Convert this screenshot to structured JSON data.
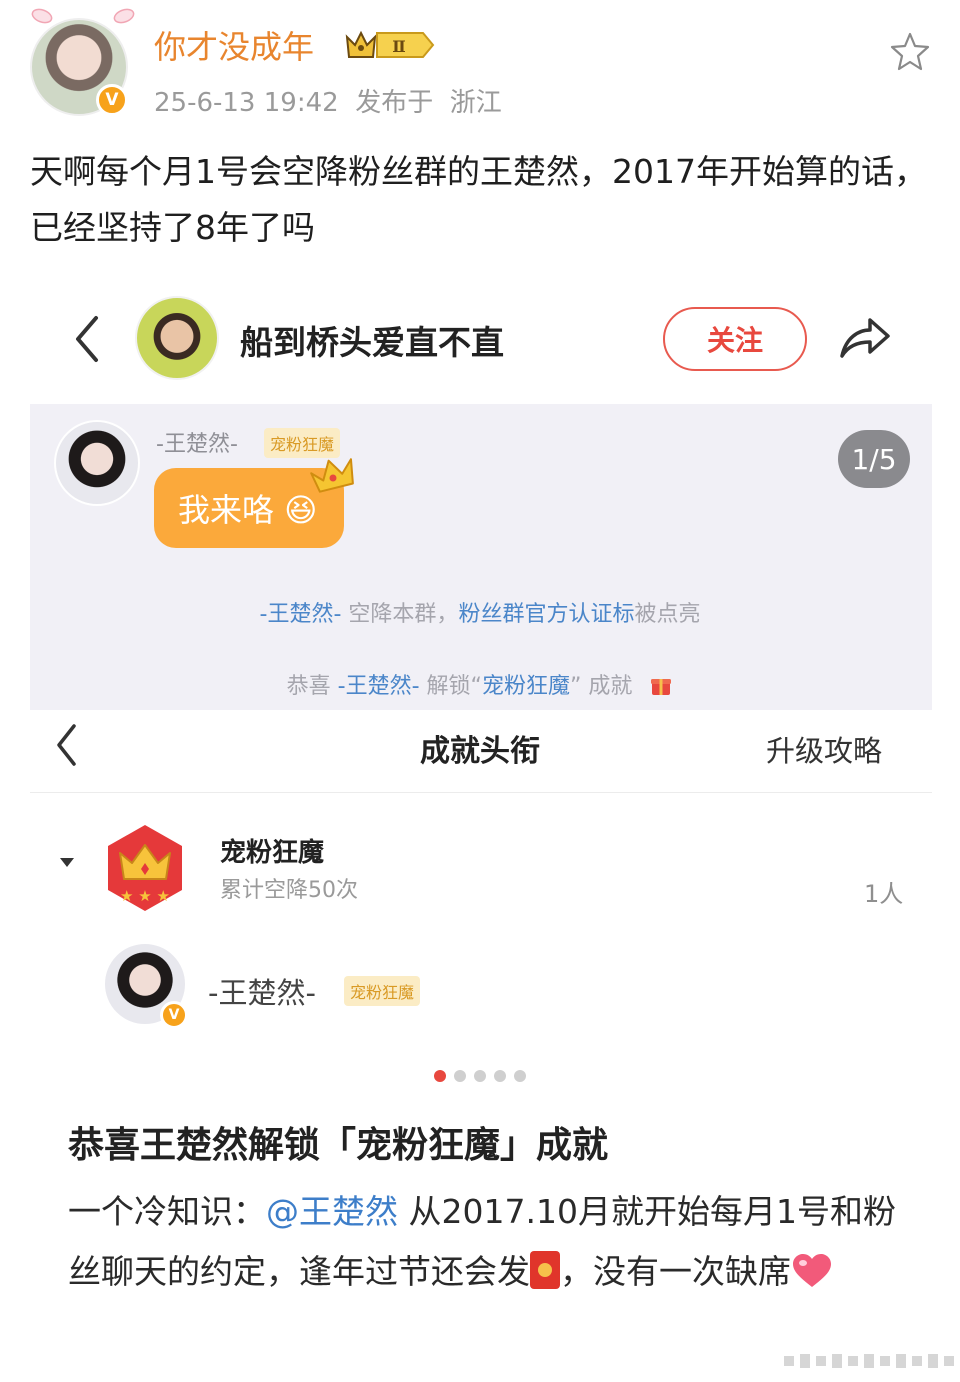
{
  "post": {
    "username": "你才没成年",
    "level_badge": "Ⅱ",
    "timestamp": "25-6-13 19:42",
    "location_prefix": "发布于",
    "location": "浙江",
    "verified_mark": "V",
    "text": "天啊每个月1号会空降粉丝群的王楚然，2017年开始算的话，已经坚持了8年了吗"
  },
  "chat_header": {
    "group_name": "船到桥头爱直不直",
    "follow_label": "关注"
  },
  "chat": {
    "sender_name": "-王楚然-",
    "sender_tag": "宠粉狂魔",
    "message": "我来咯 😆",
    "page_indicator": "1/5",
    "system_line_1": {
      "name": "-王楚然-",
      "mid": "空降本群，",
      "highlight": "粉丝群官方认证标",
      "tail": "被点亮"
    },
    "system_line_2": {
      "prefix": "恭喜",
      "name": "-王楚然-",
      "mid": "解锁",
      "quote_open": "“",
      "achievement": "宠粉狂魔",
      "quote_close": "”",
      "tail": "成就"
    }
  },
  "achievement_page": {
    "title": "成就头衔",
    "guide_label": "升级攻略",
    "achievement_name": "宠粉狂魔",
    "achievement_desc": "累计空降50次",
    "holder_count": "1人",
    "holder_name": "-王楚然-",
    "holder_tag": "宠粉狂魔",
    "holder_verified_mark": "V"
  },
  "carousel": {
    "dot_count": 5,
    "active_index": 0
  },
  "article": {
    "title": "恭喜王楚然解锁「宠粉狂魔」成就",
    "body_prefix": "一个冷知识：",
    "mention": "@王楚然",
    "body_1": " 从2017.10月就开始每月1号和粉丝聊天的约定，逢年过节还会发",
    "body_2": "，没有一次缺席"
  },
  "colors": {
    "username": "#e8852e",
    "follow": "#e8483e",
    "bubble": "#fba93b",
    "link": "#4b86c9",
    "chat_bg": "#f1f0f6"
  }
}
